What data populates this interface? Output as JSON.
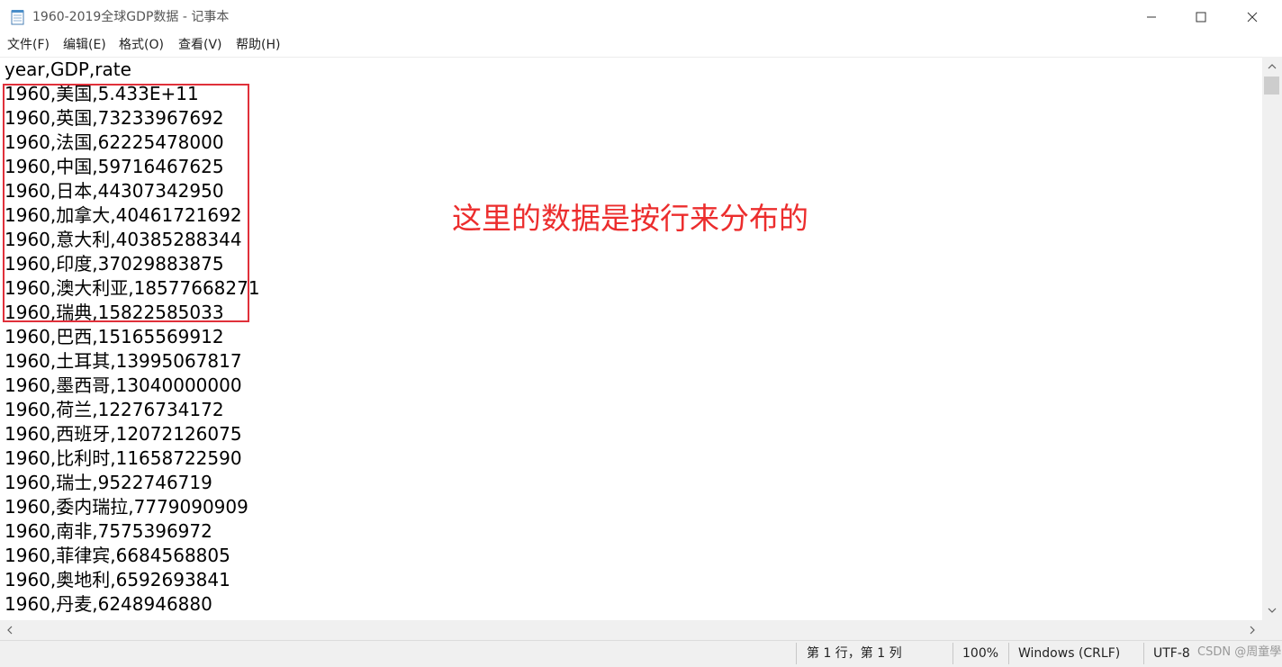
{
  "window": {
    "title": "1960-2019全球GDP数据 - 记事本"
  },
  "menu": [
    "文件(F)",
    "编辑(E)",
    "格式(O)",
    "查看(V)",
    "帮助(H)"
  ],
  "lines": [
    "year,GDP,rate",
    "1960,美国,5.433E+11",
    "1960,英国,73233967692",
    "1960,法国,62225478000",
    "1960,中国,59716467625",
    "1960,日本,44307342950",
    "1960,加拿大,40461721692",
    "1960,意大利,40385288344",
    "1960,印度,37029883875",
    "1960,澳大利亚,18577668271",
    "1960,瑞典,15822585033",
    "1960,巴西,15165569912",
    "1960,土耳其,13995067817",
    "1960,墨西哥,13040000000",
    "1960,荷兰,12276734172",
    "1960,西班牙,12072126075",
    "1960,比利时,11658722590",
    "1960,瑞士,9522746719",
    "1960,委内瑞拉,7779090909",
    "1960,南非,7575396972",
    "1960,菲律宾,6684568805",
    "1960,奥地利,6592693841",
    "1960,丹麦,6248946880"
  ],
  "annotation": {
    "text": "这里的数据是按行来分布的",
    "color": "#ec2d2d"
  },
  "status": {
    "position": "第 1 行，第 1 列",
    "zoom": "100%",
    "line_ending": "Windows (CRLF)",
    "encoding": "UTF-8"
  },
  "watermark": "CSDN @周童學"
}
